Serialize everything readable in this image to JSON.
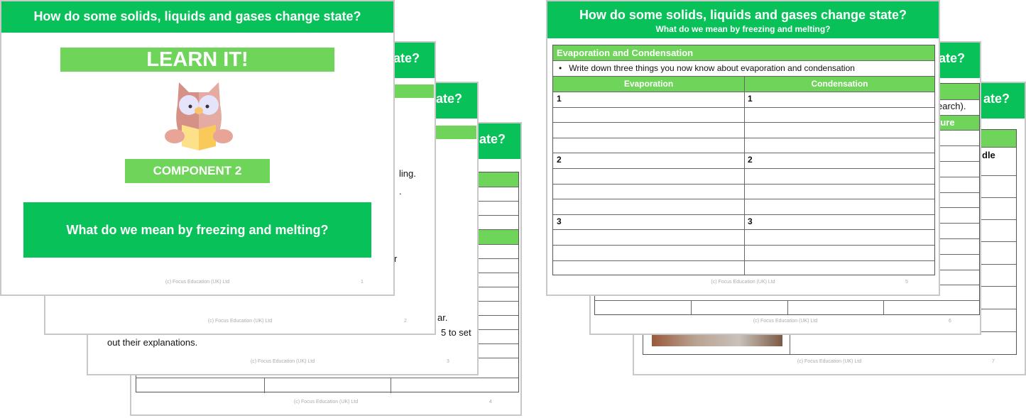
{
  "title": "How do some solids, liquids and gases change state?",
  "title_fragment": "ate?",
  "copyright": "(c) Focus Education (UK) Ltd",
  "colors": {
    "header_green": "#08c159",
    "light_green": "#6fd55a",
    "border": "#c8c8c8"
  },
  "slide1": {
    "learn_it": "LEARN IT!",
    "mascot_icon": "owl-reading-book-icon",
    "component": "COMPONENT 2",
    "question": "What do we mean by freezing and melting?",
    "page": "1"
  },
  "slide2": {
    "fragments": [
      "ling.",
      ".",
      "r"
    ],
    "page": "2"
  },
  "slide3": {
    "fragments": [
      "ar.",
      "5 to set",
      "out their explanations."
    ],
    "page": "3"
  },
  "slide4": {
    "page": "4"
  },
  "slide5": {
    "subtitle": "What do we mean by freezing and melting?",
    "section_title": "Evaporation and Condensation",
    "instruction": "Write down three things you now know about evaporation and condensation",
    "columns": [
      "Evaporation",
      "Condensation"
    ],
    "row_numbers": [
      "1",
      "2",
      "3"
    ],
    "page": "5"
  },
  "slide6": {
    "fragments": [
      "earch).",
      "ture"
    ],
    "page": "6"
  },
  "slide7": {
    "fragments": [
      "dle"
    ],
    "page": "7"
  }
}
